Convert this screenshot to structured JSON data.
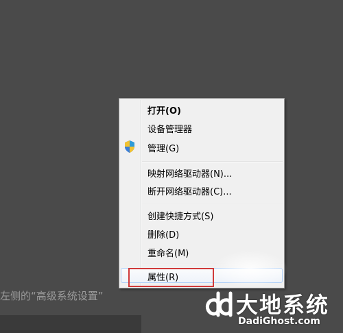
{
  "context_menu": {
    "items": [
      {
        "label": "打开(O)",
        "bold": true
      },
      {
        "label": "设备管理器"
      },
      {
        "label": "管理(G)",
        "icon": "uac-shield-icon"
      },
      {
        "label": "映射网络驱动器(N)..."
      },
      {
        "label": "断开网络驱动器(C)..."
      },
      {
        "label": "创建快捷方式(S)"
      },
      {
        "label": "删除(D)"
      },
      {
        "label": "重命名(M)"
      },
      {
        "label": "属性(R)",
        "highlighted": true
      }
    ]
  },
  "caption": "左侧的“高级系统设置”",
  "watermark": {
    "brand": "大地系统",
    "url": "DadiGhost.com"
  },
  "colors": {
    "desktop": "#4a4a4a",
    "menu_bg": "#f0f0f0",
    "highlight_border": "#d03a3a"
  }
}
